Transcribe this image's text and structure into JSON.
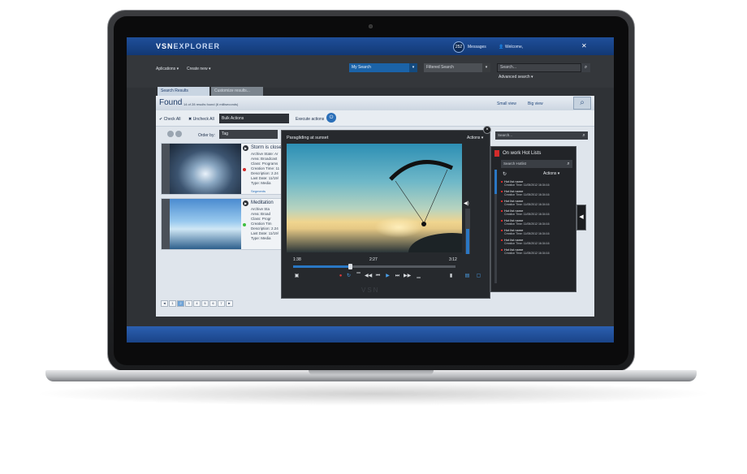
{
  "app": {
    "logo_prefix": "VSN",
    "logo_suffix": "EXPLORER",
    "messages_count": "252",
    "messages_label": "Messages",
    "welcome_label": "Welcome,"
  },
  "nav": {
    "applications": "Aplications ▾",
    "create_new": "Create new ▾",
    "my_search": "My Search",
    "filtered_search": "Filtered Search",
    "search_placeholder": "Search...",
    "advanced_search": "Advanced search ▾"
  },
  "tabs": {
    "search_results": "Search Results",
    "customize": "Customize results..."
  },
  "results": {
    "found": "Found",
    "found_detail": "14 of 28 results found (6 milliseconds)",
    "small_view": "Small view",
    "big_view": "Big view",
    "check_all": "Check All",
    "uncheck_all": "Uncheck All",
    "bulk_actions": "Bulk Actions",
    "execute_actions": "Execute actions",
    "order_by": "Order by:",
    "order_value": "Tag",
    "search_placeholder": "Search...",
    "items": [
      {
        "title": "Storm is close",
        "meta": [
          "Archive State: Ar",
          "Area: Broadcast",
          "Class: Programs",
          "Creation Time: 11",
          "Description: 2.24",
          "Last Date: 11/19/",
          "Type: Media"
        ],
        "segments": "Segments"
      },
      {
        "title": "Meditation",
        "meta": [
          "Archive Sta",
          "Area: Broad",
          "Class: Progr",
          "Creation Tim",
          "Description: 2.24",
          "Last Date: 11/19/",
          "Type: Media"
        ]
      }
    ],
    "pages": [
      "◄",
      "1",
      "2",
      "3",
      "4",
      "5",
      "6",
      "7",
      "►"
    ],
    "current_page": "2"
  },
  "player": {
    "title": "Paragliding  at sunset",
    "actions": "Actions ▾",
    "time_start": "1:38",
    "time_mid": "2:27",
    "time_end": "3:12",
    "progress": 0.35,
    "volume": 0.55,
    "logo": "VSN"
  },
  "hotlists": {
    "title": "On work Hot Lists",
    "search_placeholder": "Search Hotlist",
    "actions": "Actions ▾",
    "items": [
      {
        "name": "Hot list name",
        "time": "Creation Time: 11/05/2012 16:34:16"
      },
      {
        "name": "Hot list name",
        "time": "Creation Time: 11/05/2012 16:34:16"
      },
      {
        "name": "Hot list name",
        "time": "Creation Time: 11/05/2012 16:34:16"
      },
      {
        "name": "Hot list name",
        "time": "Creation Time: 11/05/2012 16:34:16"
      },
      {
        "name": "Hot list name",
        "time": "Creation Time: 11/05/2012 16:34:16"
      },
      {
        "name": "Hot list name",
        "time": "Creation Time: 11/05/2012 16:34:16"
      },
      {
        "name": "Hot list name",
        "time": "Creation Time: 11/05/2012 16:34:16"
      },
      {
        "name": "Hot list name",
        "time": "Creation Time: 11/05/2012 16:34:16"
      }
    ]
  },
  "icons": {
    "tools": "tools-icon",
    "user": "user-icon",
    "search": "search-icon",
    "play": "play-icon",
    "close": "close-icon",
    "refresh": "refresh-icon",
    "volume": "volume-icon",
    "bookmark": "bookmark-icon"
  },
  "colors": {
    "brand_blue": "#1b63a8",
    "topbar": "#1f4f9a",
    "accent_red": "#d32b2b"
  }
}
